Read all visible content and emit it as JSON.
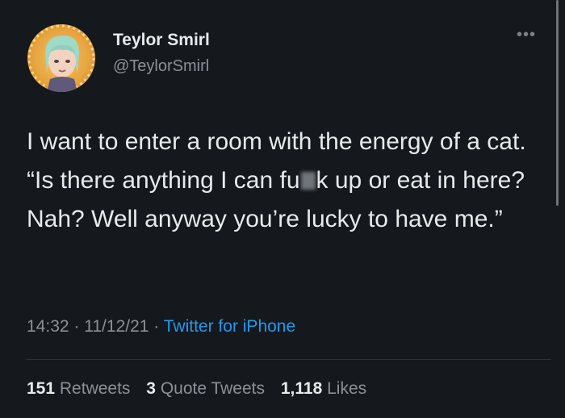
{
  "author": {
    "display_name": "Teylor Smirl",
    "handle": "@TeylorSmirl"
  },
  "more_icon": "ellipsis-icon",
  "tweet": {
    "text_part1": "I want to enter a room with the energy of a cat. “Is there anything I can fu",
    "text_part2": "k up or eat in here? Nah? Well anyway you’re lucky to have me.”"
  },
  "meta": {
    "time": "14:32",
    "sep1": "·",
    "date": "11/12/21",
    "sep2": "·",
    "source": "Twitter for iPhone"
  },
  "stats": {
    "retweets_count": "151",
    "retweets_label": "Retweets",
    "quotes_count": "3",
    "quotes_label": "Quote Tweets",
    "likes_count": "1,118",
    "likes_label": "Likes"
  },
  "colors": {
    "background": "#15181c",
    "link": "#1d9bf0",
    "secondary_text": "#8b9199"
  }
}
